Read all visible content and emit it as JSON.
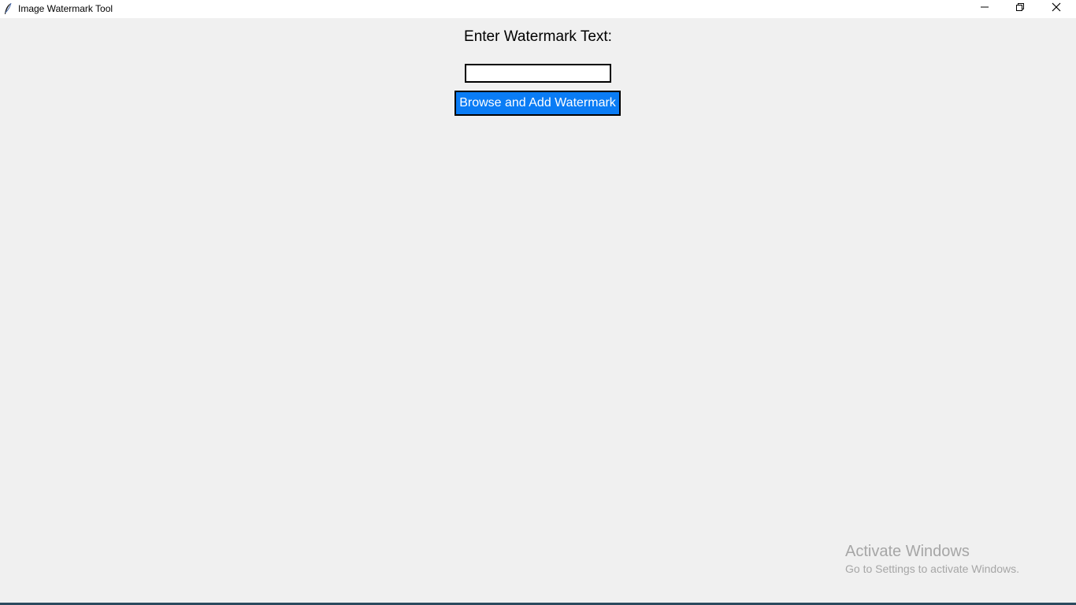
{
  "window": {
    "title": "Image Watermark Tool",
    "app_icon": "feather-icon",
    "controls": {
      "minimize_icon": "minimize-icon",
      "maximize_icon": "restore-icon",
      "close_icon": "close-icon"
    }
  },
  "form": {
    "label": "Enter Watermark Text:",
    "input_value": "",
    "button_label": "Browse and Add Watermark"
  },
  "overlay": {
    "activate_title": "Activate Windows",
    "activate_subtitle": "Go to Settings to activate Windows."
  },
  "colors": {
    "background": "#f0f0f0",
    "button_bg": "#0a7cf5",
    "button_text": "#ffffff",
    "watermark_text": "#a6a6a6"
  }
}
